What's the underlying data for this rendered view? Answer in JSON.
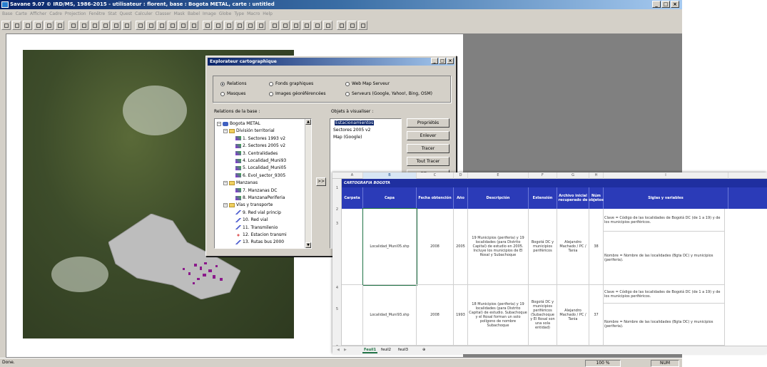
{
  "window": {
    "title": "Savane 9.07 © IRD/MS, 1986-2015 - utilisateur : florent, base : Bogota METAL, carte : untitled",
    "minimize": "_",
    "maximize": "□",
    "close": "×"
  },
  "menu": [
    "Base",
    "Carte",
    "Afficher",
    "Cadre",
    "Projection",
    "Fenêtre",
    "Stat",
    "Quest",
    "Calculer",
    "Classer",
    "Mask",
    "Babel",
    "Image",
    "Globe",
    "Type",
    "Macro",
    "Help"
  ],
  "status": {
    "text": "Done.",
    "zoom": "100 %",
    "num": "NUM"
  },
  "explorer": {
    "title": "Explorateur cartographique",
    "radios": [
      {
        "label": "Relations",
        "checked": true
      },
      {
        "label": "Fonds graphiques",
        "checked": false
      },
      {
        "label": "Web Map Serveur",
        "checked": false
      },
      {
        "label": "Masques",
        "checked": false
      },
      {
        "label": "Images géoréférencées",
        "checked": false
      },
      {
        "label": "Serveurs (Google, Yahoo!, Bing, OSM)",
        "checked": false
      }
    ],
    "relations_label": "Relations de la base :",
    "objects_label": "Objets à visualiser :",
    "tree": [
      {
        "label": "Bogota METAL",
        "icon": "database-icon",
        "level": 0,
        "expander": "−"
      },
      {
        "label": "División territorial",
        "icon": "folder-icon",
        "level": 1,
        "expander": "−"
      },
      {
        "label": "1. Sectores 1993 v2",
        "icon": "layer-icon",
        "level": 2
      },
      {
        "label": "2. Sectores 2005 v2",
        "icon": "layer-icon",
        "level": 2
      },
      {
        "label": "3. Centralidades",
        "icon": "layer-icon",
        "level": 2
      },
      {
        "label": "4. Localidad_Muni93",
        "icon": "layer-icon",
        "level": 2
      },
      {
        "label": "5. Localidad_Muni05",
        "icon": "layer-icon",
        "level": 2
      },
      {
        "label": "6. Evol_sector_9305",
        "icon": "layer-icon",
        "level": 2
      },
      {
        "label": "Manzanas",
        "icon": "folder-icon",
        "level": 1,
        "expander": "−"
      },
      {
        "label": "7. Manzanas DC",
        "icon": "layer-icon",
        "level": 2
      },
      {
        "label": "8. ManzanaPeriferia",
        "icon": "layer-icon",
        "level": 2
      },
      {
        "label": "Vías y transporte",
        "icon": "folder-icon",
        "level": 1,
        "expander": "−"
      },
      {
        "label": "9. Red vial princip",
        "icon": "line-icon",
        "level": 2
      },
      {
        "label": "10. Red vial",
        "icon": "line-icon",
        "level": 2
      },
      {
        "label": "11. Transmilenio",
        "icon": "line-icon",
        "level": 2
      },
      {
        "label": "12. Estacion transmi",
        "icon": "point-icon",
        "level": 2
      },
      {
        "label": "13. Rutas bus 2000",
        "icon": "line-icon",
        "level": 2
      }
    ],
    "add_button": ">>",
    "objects": [
      {
        "label": "Estacionamientos",
        "selected": true
      },
      {
        "label": "Sectores 2005 v2",
        "selected": false
      },
      {
        "label": "Map (Google)",
        "selected": false
      }
    ],
    "buttons": [
      "Propriétés",
      "Enlever",
      "Tracer",
      "Tout Tracer",
      "Effacer"
    ]
  },
  "spreadsheet": {
    "columns": [
      "A",
      "B",
      "C",
      "D",
      "E",
      "F",
      "G",
      "H",
      "I"
    ],
    "title": "CARTOGRAFIA BOGOTA",
    "headers": [
      "Carpeta",
      "Capa",
      "Fecha obtención",
      "Año",
      "Descripción",
      "Extensión",
      "Archivo inicial recuperado de",
      "Núm objetos",
      "Siglas y variables"
    ],
    "row_numbers": [
      "1",
      "2",
      "3",
      "4",
      "5",
      "6"
    ],
    "rows": [
      {
        "capa": "Localidad_Muni05.shp",
        "fecha": "2008",
        "anio": "2005",
        "desc": "19 Municipios (periferia) y 19 localidades (para Distrito Capital) de estudio en 2005. Incluye los municipios de El Rosal y Subachoque",
        "ext": "Bogotá DC y municipios periféricos",
        "archivo": "Alejandro Machado / PC / Tania",
        "num": "38",
        "siglas1": "Clave = Código de las localidades de Bogotá DC (de 1 a 19) y de los municipios periféricos.",
        "siglas2": "Nombre = Nombre de las localidades (Bgta DC) y municipios (periferia)."
      },
      {
        "capa": "Localidad_Muni93.shp",
        "fecha": "2008",
        "anio": "1993",
        "desc": "18 Municipios (periferia) y 19 localidades (para Distrito Capital) de estudio. Subachoque y el Rosal forman un solo polígono de nombre Subachoque",
        "ext": "Bogotá DC y municipios periféricos (Subachoque y El Rosal son una sola entidad)",
        "archivo": "Alejandro Machado / PC / Tania",
        "num": "37",
        "siglas1": "Clave = Código de las localidades de Bogotá DC (de 1 a 19) y de los municipios periféricos.",
        "siglas2": "Nombre = Nombre de las localidades (Bgta DC) y municipios (periferia)."
      }
    ],
    "sheets": [
      "Feuil1",
      "feuil2",
      "feuil3"
    ],
    "add_sheet": "⊕"
  }
}
